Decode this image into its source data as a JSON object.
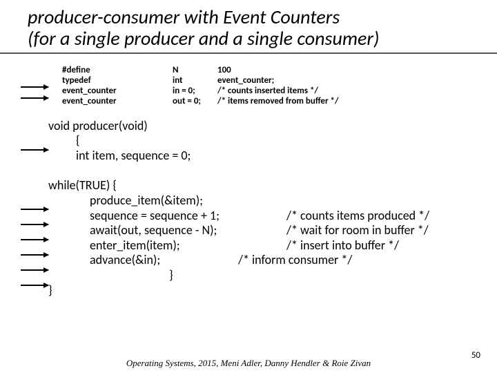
{
  "title_line1": "producer-consumer with Event  Counters",
  "title_line2": "(for a single producer and a single consumer)",
  "decl": {
    "r1": {
      "a": "#define",
      "b": "N",
      "c": "100"
    },
    "r2": {
      "a": "typedef",
      "b": "int",
      "c": "event_counter;"
    },
    "r3": {
      "a": "event_counter",
      "b": "in = 0;",
      "c": "/* counts inserted items */"
    },
    "r4": {
      "a": "event_counter",
      "b": "out = 0;",
      "c": "/* items removed from buffer */"
    }
  },
  "code": {
    "sig": "void producer(void)",
    "brace_open": "{",
    "vars": "int  item, sequence = 0;",
    "loop": "while(TRUE)  {",
    "l1": "produce_item(&item);",
    "l2": "sequence = sequence + 1;",
    "l2c": "/* counts items produced */",
    "l3": "await(out, sequence - N);",
    "l3c": "/* wait for room in buffer */",
    "l4": "enter_item(item);",
    "l4c": "/* insert into buffer */",
    "l5": "advance(&in);",
    "l5c": "/* inform consumer */",
    "brace_inner": "}",
    "brace_close": "}"
  },
  "footer": "Operating Systems, 2015, Meni Adler, Danny Hendler & Roie Zivan",
  "pagenum": "50"
}
